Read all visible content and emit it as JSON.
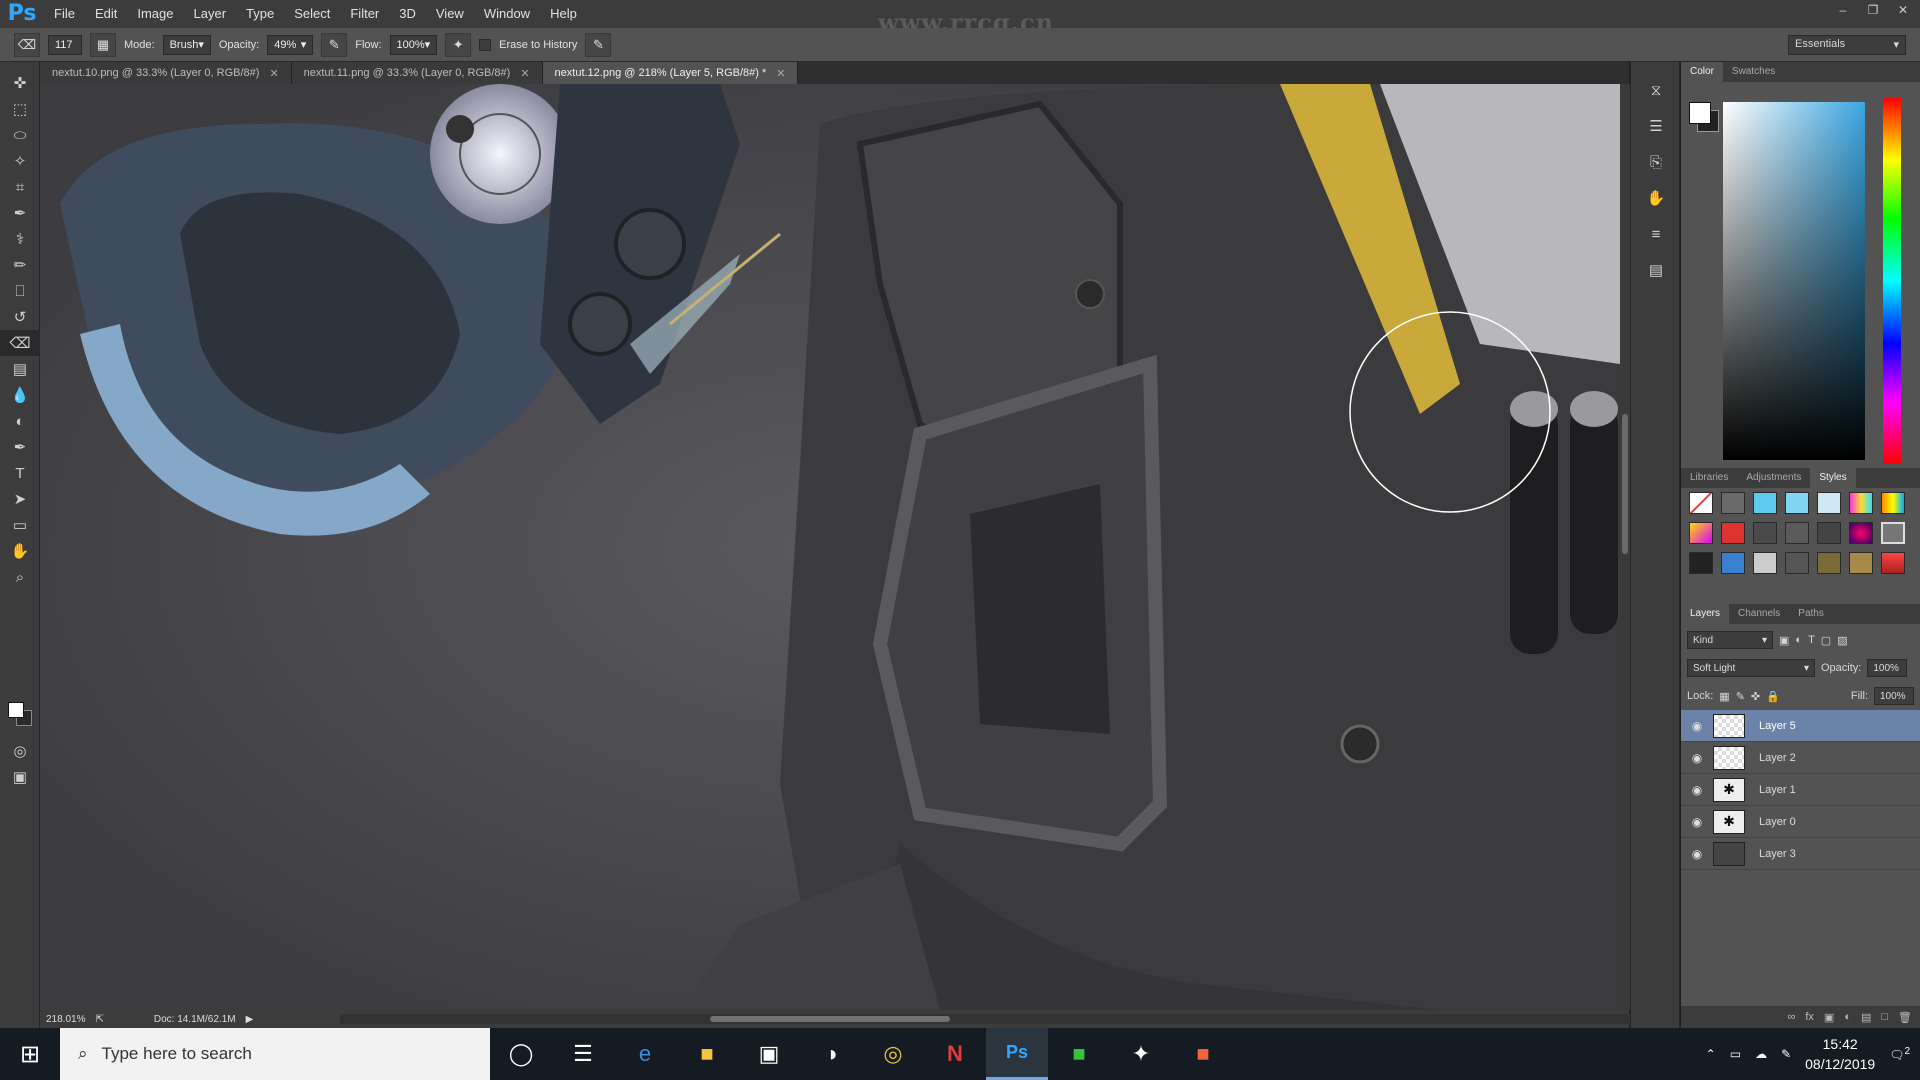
{
  "app": {
    "logo": "Ps",
    "menu": [
      "File",
      "Edit",
      "Image",
      "Layer",
      "Type",
      "Select",
      "Filter",
      "3D",
      "View",
      "Window",
      "Help"
    ],
    "watermark": "www.rrcg.cn"
  },
  "options_bar": {
    "brush_size": "117",
    "mode_label": "Mode:",
    "mode_value": "Brush",
    "opacity_label": "Opacity:",
    "opacity_value": "49%",
    "flow_label": "Flow:",
    "flow_value": "100%",
    "erase_history_label": "Erase to History",
    "workspace": "Essentials"
  },
  "tabs": [
    {
      "label": "nextut.10.png @ 33.3% (Layer 0, RGB/8#)"
    },
    {
      "label": "nextut.11.png @ 33.3% (Layer 0, RGB/8#)"
    },
    {
      "label": "nextut.12.png @ 218% (Layer 5, RGB/8#) *"
    }
  ],
  "status": {
    "zoom": "218.01%",
    "doc": "Doc: 14.1M/62.1M"
  },
  "panels": {
    "color_tabs": [
      "Color",
      "Swatches"
    ],
    "style_tabs": [
      "Libraries",
      "Adjustments",
      "Styles"
    ],
    "layer_tabs": [
      "Layers",
      "Channels",
      "Paths"
    ],
    "filter_kind": "Kind",
    "blend_mode": "Soft Light",
    "opacity_label": "Opacity:",
    "opacity_value": "100%",
    "lock_label": "Lock:",
    "fill_label": "Fill:",
    "fill_value": "100%",
    "layers": [
      {
        "name": "Layer 5"
      },
      {
        "name": "Layer 2"
      },
      {
        "name": "Layer 1"
      },
      {
        "name": "Layer 0"
      },
      {
        "name": "Layer 3"
      }
    ]
  },
  "taskbar": {
    "search_placeholder": "Type here to search",
    "time": "15:42",
    "date": "08/12/2019",
    "notification_count": "2"
  },
  "colors": {
    "accent": "#31a8ff",
    "layer_selected": "#6b83a8",
    "brush_cursor": "#ffffff"
  }
}
